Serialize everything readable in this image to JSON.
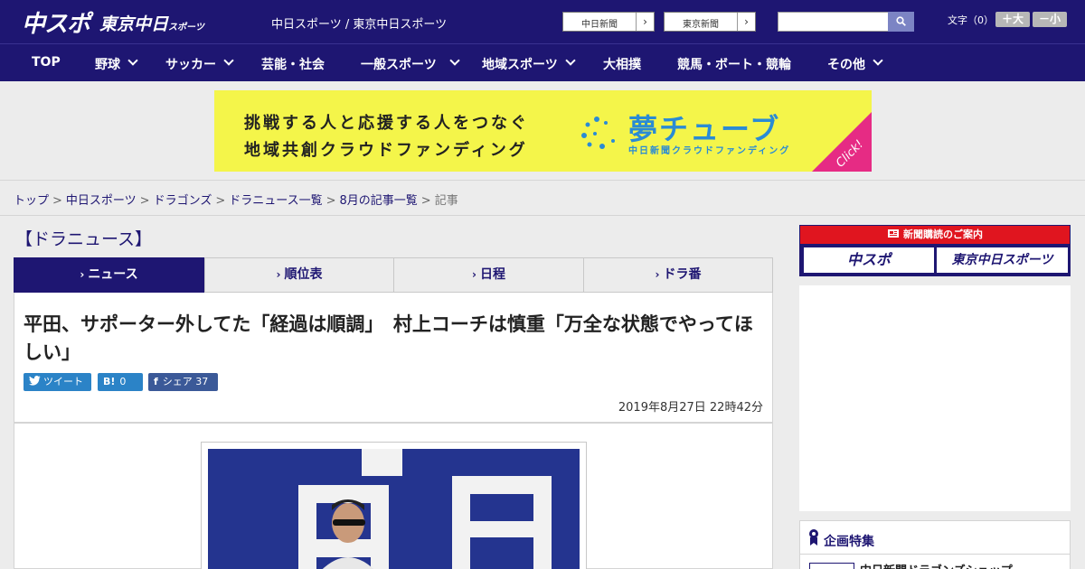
{
  "header": {
    "logo_main": "中スポ",
    "logo_tokyo": "東京中日",
    "logo_tokyo_small": "スポーツ",
    "site_title": "中日スポーツ / 東京中日スポーツ",
    "paper_links": [
      {
        "label": "中日新聞"
      },
      {
        "label": "東京新聞"
      }
    ],
    "search": {
      "value": "",
      "placeholder": ""
    },
    "font_size_label": "文字（0）",
    "font_bigger": "＋大",
    "font_smaller": "－小"
  },
  "nav": {
    "items": [
      {
        "label": "TOP",
        "dropdown": false
      },
      {
        "label": "野球",
        "dropdown": true
      },
      {
        "label": "サッカー",
        "dropdown": true
      },
      {
        "label": "芸能・社会",
        "dropdown": false
      },
      {
        "label": "一般スポーツ",
        "dropdown": true
      },
      {
        "label": "地域スポーツ",
        "dropdown": true
      },
      {
        "label": "大相撲",
        "dropdown": false
      },
      {
        "label": "競馬・ボート・競輪",
        "dropdown": false
      },
      {
        "label": "その他",
        "dropdown": true
      }
    ]
  },
  "banner": {
    "line1": "挑戦する人と応援する人をつなぐ",
    "line2": "地域共創クラウドファンディング",
    "brand": "夢チューブ",
    "brand_sub": "中日新聞クラウドファンディング",
    "click": "Click!"
  },
  "breadcrumb": {
    "items": [
      "トップ",
      "中日スポーツ",
      "ドラゴンズ",
      "ドラニュース一覧",
      "8月の記事一覧"
    ],
    "separator": ">",
    "current": "記事"
  },
  "section": {
    "title": "【ドラニュース】"
  },
  "tabs": [
    {
      "label": "ニュース",
      "active": true
    },
    {
      "label": "順位表",
      "active": false
    },
    {
      "label": "日程",
      "active": false
    },
    {
      "label": "ドラ番",
      "active": false
    }
  ],
  "article": {
    "headline": "平田、サポーター外してた「経過は順調」　村上コーチは慎重「万全な状態でやってほしい」",
    "share": {
      "tweet": "ツイート",
      "hatena_icon": "B!",
      "hatena_count": "0",
      "facebook_icon": "f",
      "facebook_label": "シェア",
      "facebook_count": "37"
    },
    "datetime": "2019年8月27日 22時42分"
  },
  "sidebar": {
    "subscribe_head": "新聞購読のご案内",
    "subscribe_buttons": [
      "中スポ",
      "東京中日スポーツ"
    ],
    "feature_title": "企画特集",
    "feature_item": "中日新聞ドラゴンズショップ"
  },
  "colors": {
    "brand_navy": "#1e1672",
    "banner_yellow": "#f4f54a",
    "banner_blue": "#2a8bd4",
    "banner_pink": "#e62b84",
    "subscribe_red": "#e0151f",
    "twitter": "#2b83c7",
    "facebook": "#3b5998"
  },
  "icons": {
    "search": "search-icon",
    "twitter": "twitter-icon",
    "facebook": "facebook-icon",
    "ribbon": "ribbon-icon",
    "newspaper": "newspaper-icon"
  }
}
